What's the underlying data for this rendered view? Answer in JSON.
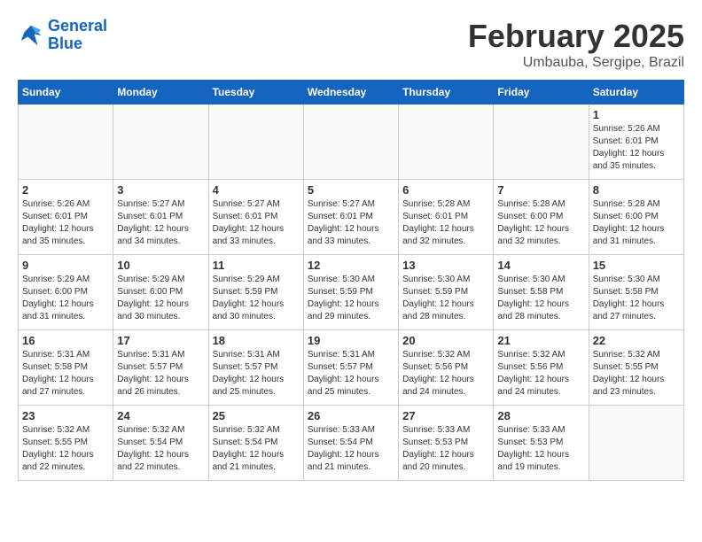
{
  "logo": {
    "line1": "General",
    "line2": "Blue"
  },
  "title": "February 2025",
  "location": "Umbauba, Sergipe, Brazil",
  "days_of_week": [
    "Sunday",
    "Monday",
    "Tuesday",
    "Wednesday",
    "Thursday",
    "Friday",
    "Saturday"
  ],
  "weeks": [
    [
      {
        "day": "",
        "info": ""
      },
      {
        "day": "",
        "info": ""
      },
      {
        "day": "",
        "info": ""
      },
      {
        "day": "",
        "info": ""
      },
      {
        "day": "",
        "info": ""
      },
      {
        "day": "",
        "info": ""
      },
      {
        "day": "1",
        "info": "Sunrise: 5:26 AM\nSunset: 6:01 PM\nDaylight: 12 hours\nand 35 minutes."
      }
    ],
    [
      {
        "day": "2",
        "info": "Sunrise: 5:26 AM\nSunset: 6:01 PM\nDaylight: 12 hours\nand 35 minutes."
      },
      {
        "day": "3",
        "info": "Sunrise: 5:27 AM\nSunset: 6:01 PM\nDaylight: 12 hours\nand 34 minutes."
      },
      {
        "day": "4",
        "info": "Sunrise: 5:27 AM\nSunset: 6:01 PM\nDaylight: 12 hours\nand 33 minutes."
      },
      {
        "day": "5",
        "info": "Sunrise: 5:27 AM\nSunset: 6:01 PM\nDaylight: 12 hours\nand 33 minutes."
      },
      {
        "day": "6",
        "info": "Sunrise: 5:28 AM\nSunset: 6:01 PM\nDaylight: 12 hours\nand 32 minutes."
      },
      {
        "day": "7",
        "info": "Sunrise: 5:28 AM\nSunset: 6:00 PM\nDaylight: 12 hours\nand 32 minutes."
      },
      {
        "day": "8",
        "info": "Sunrise: 5:28 AM\nSunset: 6:00 PM\nDaylight: 12 hours\nand 31 minutes."
      }
    ],
    [
      {
        "day": "9",
        "info": "Sunrise: 5:29 AM\nSunset: 6:00 PM\nDaylight: 12 hours\nand 31 minutes."
      },
      {
        "day": "10",
        "info": "Sunrise: 5:29 AM\nSunset: 6:00 PM\nDaylight: 12 hours\nand 30 minutes."
      },
      {
        "day": "11",
        "info": "Sunrise: 5:29 AM\nSunset: 5:59 PM\nDaylight: 12 hours\nand 30 minutes."
      },
      {
        "day": "12",
        "info": "Sunrise: 5:30 AM\nSunset: 5:59 PM\nDaylight: 12 hours\nand 29 minutes."
      },
      {
        "day": "13",
        "info": "Sunrise: 5:30 AM\nSunset: 5:59 PM\nDaylight: 12 hours\nand 28 minutes."
      },
      {
        "day": "14",
        "info": "Sunrise: 5:30 AM\nSunset: 5:58 PM\nDaylight: 12 hours\nand 28 minutes."
      },
      {
        "day": "15",
        "info": "Sunrise: 5:30 AM\nSunset: 5:58 PM\nDaylight: 12 hours\nand 27 minutes."
      }
    ],
    [
      {
        "day": "16",
        "info": "Sunrise: 5:31 AM\nSunset: 5:58 PM\nDaylight: 12 hours\nand 27 minutes."
      },
      {
        "day": "17",
        "info": "Sunrise: 5:31 AM\nSunset: 5:57 PM\nDaylight: 12 hours\nand 26 minutes."
      },
      {
        "day": "18",
        "info": "Sunrise: 5:31 AM\nSunset: 5:57 PM\nDaylight: 12 hours\nand 25 minutes."
      },
      {
        "day": "19",
        "info": "Sunrise: 5:31 AM\nSunset: 5:57 PM\nDaylight: 12 hours\nand 25 minutes."
      },
      {
        "day": "20",
        "info": "Sunrise: 5:32 AM\nSunset: 5:56 PM\nDaylight: 12 hours\nand 24 minutes."
      },
      {
        "day": "21",
        "info": "Sunrise: 5:32 AM\nSunset: 5:56 PM\nDaylight: 12 hours\nand 24 minutes."
      },
      {
        "day": "22",
        "info": "Sunrise: 5:32 AM\nSunset: 5:55 PM\nDaylight: 12 hours\nand 23 minutes."
      }
    ],
    [
      {
        "day": "23",
        "info": "Sunrise: 5:32 AM\nSunset: 5:55 PM\nDaylight: 12 hours\nand 22 minutes."
      },
      {
        "day": "24",
        "info": "Sunrise: 5:32 AM\nSunset: 5:54 PM\nDaylight: 12 hours\nand 22 minutes."
      },
      {
        "day": "25",
        "info": "Sunrise: 5:32 AM\nSunset: 5:54 PM\nDaylight: 12 hours\nand 21 minutes."
      },
      {
        "day": "26",
        "info": "Sunrise: 5:33 AM\nSunset: 5:54 PM\nDaylight: 12 hours\nand 21 minutes."
      },
      {
        "day": "27",
        "info": "Sunrise: 5:33 AM\nSunset: 5:53 PM\nDaylight: 12 hours\nand 20 minutes."
      },
      {
        "day": "28",
        "info": "Sunrise: 5:33 AM\nSunset: 5:53 PM\nDaylight: 12 hours\nand 19 minutes."
      },
      {
        "day": "",
        "info": ""
      }
    ]
  ]
}
